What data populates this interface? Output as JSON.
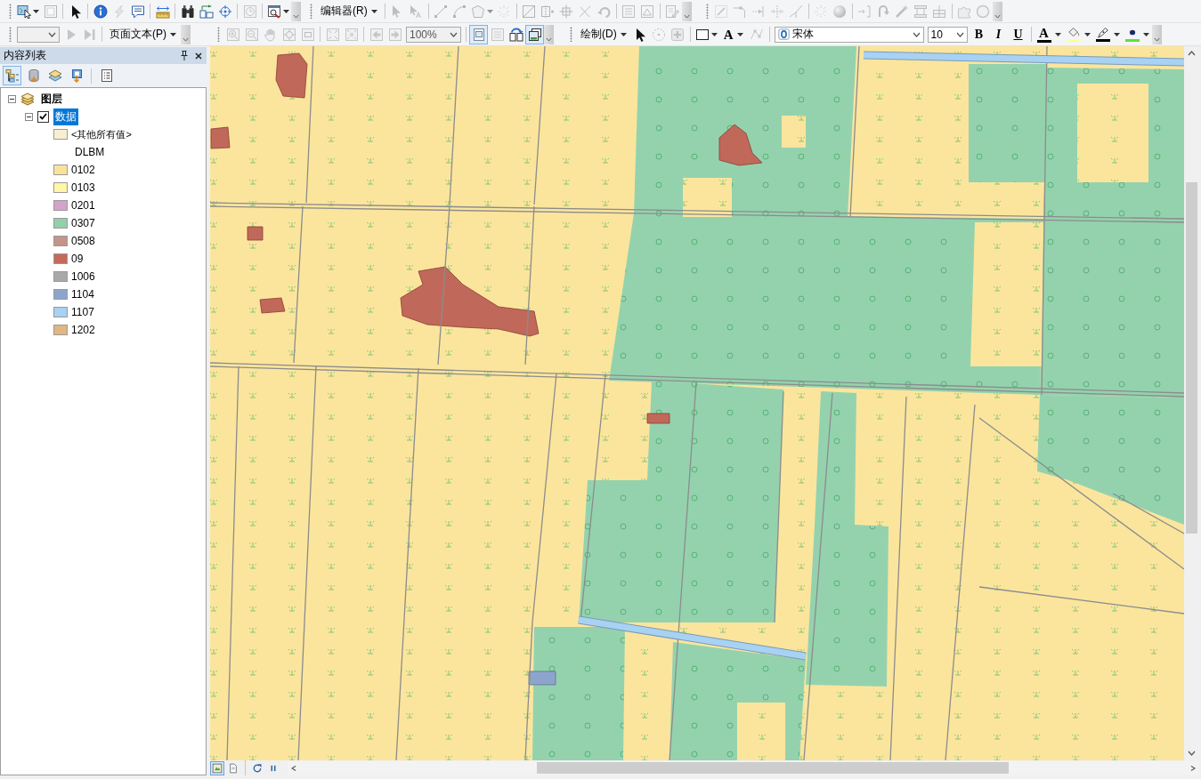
{
  "toolbar_rows": [
    {
      "groups": [
        {
          "items": [
            {
              "kind": "tool_menu",
              "disabled": false
            },
            {
              "kind": "tool",
              "disabled": true
            },
            {
              "kind": "separator"
            },
            {
              "kind": "tool",
              "disabled": false
            },
            {
              "kind": "separator"
            },
            {
              "kind": "tool",
              "disabled": false
            },
            {
              "kind": "tool",
              "disabled": true
            },
            {
              "kind": "tool",
              "disabled": false
            },
            {
              "kind": "separator"
            },
            {
              "kind": "tool",
              "disabled": false
            },
            {
              "kind": "separator"
            },
            {
              "kind": "tool",
              "disabled": false
            },
            {
              "kind": "tool",
              "disabled": false
            },
            {
              "kind": "tool",
              "disabled": false
            },
            {
              "kind": "separator"
            },
            {
              "kind": "tool",
              "disabled": true
            },
            {
              "kind": "separator"
            },
            {
              "kind": "tool_menu",
              "disabled": false
            }
          ]
        },
        {
          "items": [
            {
              "kind": "menu",
              "label": "编辑器(R)"
            },
            {
              "kind": "separator"
            },
            {
              "kind": "tool",
              "disabled": true
            },
            {
              "kind": "tool",
              "disabled": true
            },
            {
              "kind": "separator"
            },
            {
              "kind": "tool",
              "disabled": true
            },
            {
              "kind": "tool",
              "disabled": true
            },
            {
              "kind": "tool_menu",
              "disabled": true
            },
            {
              "kind": "tool",
              "disabled": true
            },
            {
              "kind": "separator"
            },
            {
              "kind": "tool",
              "disabled": true
            },
            {
              "kind": "tool",
              "disabled": true
            },
            {
              "kind": "tool",
              "disabled": true
            },
            {
              "kind": "tool",
              "disabled": true
            },
            {
              "kind": "tool",
              "disabled": true
            },
            {
              "kind": "separator"
            },
            {
              "kind": "tool",
              "disabled": true
            },
            {
              "kind": "tool",
              "disabled": true
            },
            {
              "kind": "separator"
            },
            {
              "kind": "tool",
              "disabled": true
            }
          ]
        },
        {
          "items": [
            {
              "kind": "tool",
              "disabled": true
            },
            {
              "kind": "tool",
              "disabled": true
            },
            {
              "kind": "tool",
              "disabled": true
            },
            {
              "kind": "tool",
              "disabled": true
            },
            {
              "kind": "tool",
              "disabled": true
            },
            {
              "kind": "separator"
            },
            {
              "kind": "tool",
              "disabled": true
            },
            {
              "kind": "tool",
              "disabled": true
            },
            {
              "kind": "separator"
            },
            {
              "kind": "tool",
              "disabled": true
            },
            {
              "kind": "tool",
              "disabled": true
            },
            {
              "kind": "tool",
              "disabled": true
            },
            {
              "kind": "tool",
              "disabled": true
            },
            {
              "kind": "tool",
              "disabled": true
            },
            {
              "kind": "separator"
            },
            {
              "kind": "tool",
              "disabled": true
            },
            {
              "kind": "tool",
              "disabled": true
            }
          ]
        }
      ]
    },
    {
      "groups": [
        {
          "items": [
            {
              "kind": "combo",
              "disabled": true
            },
            {
              "kind": "tool",
              "disabled": true
            },
            {
              "kind": "tool",
              "disabled": true
            },
            {
              "kind": "separator"
            },
            {
              "kind": "menu",
              "label": "页面文本(P)"
            }
          ]
        },
        {
          "items": [
            {
              "kind": "tool",
              "disabled": true
            },
            {
              "kind": "tool",
              "disabled": true
            },
            {
              "kind": "tool",
              "disabled": true
            },
            {
              "kind": "tool",
              "disabled": true
            },
            {
              "kind": "tool",
              "disabled": true
            },
            {
              "kind": "separator"
            },
            {
              "kind": "tool",
              "disabled": true
            },
            {
              "kind": "tool",
              "disabled": true
            },
            {
              "kind": "separator"
            },
            {
              "kind": "tool",
              "disabled": true
            },
            {
              "kind": "tool",
              "disabled": true
            },
            {
              "kind": "combo",
              "value": "100%",
              "disabled": true
            },
            {
              "kind": "separator"
            },
            {
              "kind": "toggle",
              "selected": true
            },
            {
              "kind": "tool",
              "disabled": true
            },
            {
              "kind": "tool",
              "disabled": false
            },
            {
              "kind": "toggle",
              "selected": true
            }
          ]
        },
        {
          "items": [
            {
              "kind": "menu",
              "label": "绘制(D)"
            },
            {
              "kind": "tool",
              "disabled": false
            },
            {
              "kind": "tool",
              "disabled": true
            },
            {
              "kind": "tool",
              "disabled": true
            },
            {
              "kind": "separator"
            },
            {
              "kind": "tool_menu",
              "disabled": false
            },
            {
              "kind": "text_menu",
              "label": "A"
            },
            {
              "kind": "tool",
              "disabled": true
            },
            {
              "kind": "separator"
            },
            {
              "kind": "combo",
              "value": "宋体",
              "disabled": false
            },
            {
              "kind": "combo",
              "value": "10",
              "disabled": false
            },
            {
              "kind": "text_tool",
              "label": "B"
            },
            {
              "kind": "text_tool",
              "label": "I"
            },
            {
              "kind": "text_tool",
              "label": "U"
            },
            {
              "kind": "separator"
            },
            {
              "kind": "color",
              "label": "A",
              "color": "#000000"
            },
            {
              "kind": "color",
              "color": "#ffff9e"
            },
            {
              "kind": "color",
              "color": "#000000"
            },
            {
              "kind": "color",
              "color": "#5fe03a"
            }
          ]
        }
      ]
    }
  ],
  "contents_panel": {
    "title": "内容列表",
    "view_tabs": [
      {
        "selected": true
      },
      {
        "selected": false
      },
      {
        "selected": false
      },
      {
        "selected": false
      }
    ],
    "tree": [
      {
        "kind": "data_frame",
        "label": "图层",
        "expanded": true,
        "selected": false,
        "children": [
          {
            "kind": "layer",
            "label": "数据",
            "expanded": true,
            "checked": true,
            "selected": true,
            "legend": {
              "other_values": {
                "label": "<其他所有值>",
                "color": "#f7f0d0"
              },
              "field": "DLBM",
              "classes": [
                {
                  "label": "0102",
                  "color": "#f9e39b"
                },
                {
                  "label": "0103",
                  "color": "#fff7a6"
                },
                {
                  "label": "0201",
                  "color": "#d5a3c9"
                },
                {
                  "label": "0307",
                  "color": "#92cfaa"
                },
                {
                  "label": "0508",
                  "color": "#c49589"
                },
                {
                  "label": "09",
                  "color": "#c46a58"
                },
                {
                  "label": "1006",
                  "color": "#a9a9a9"
                },
                {
                  "label": "1104",
                  "color": "#8da5cc"
                },
                {
                  "label": "1107",
                  "color": "#a8d1f2"
                },
                {
                  "label": "1202",
                  "color": "#e0b683"
                }
              ]
            }
          }
        ]
      }
    ]
  },
  "map_view": {
    "view_buttons": [
      {
        "selected": true
      },
      {
        "selected": false
      }
    ]
  }
}
